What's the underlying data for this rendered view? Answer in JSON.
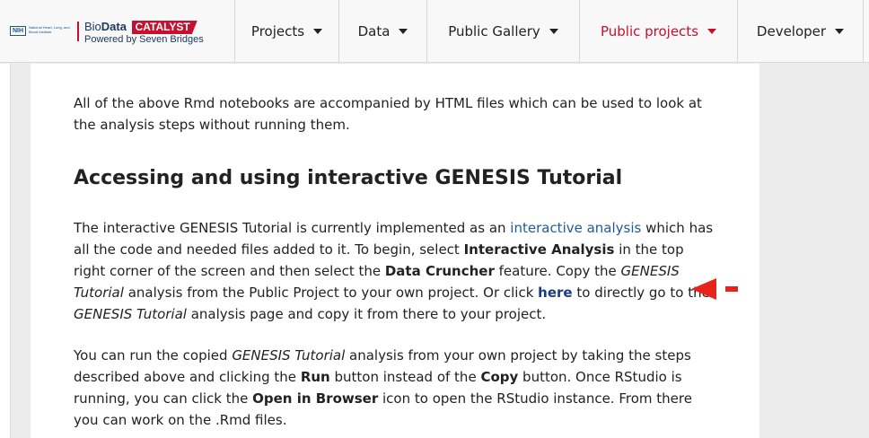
{
  "brand": {
    "nih_badge": "NIH",
    "nih_text": "National Heart, Lung, and Blood Institute",
    "bio": "Bio",
    "data": "Data",
    "catalyst": "CATALYST",
    "powered_by": "Powered by Seven Bridges",
    "accent_color": "#c8102e"
  },
  "nav": {
    "items": [
      {
        "label": "Projects",
        "active": false
      },
      {
        "label": "Data",
        "active": false
      },
      {
        "label": "Public Gallery",
        "active": false
      },
      {
        "label": "Public projects",
        "active": true
      },
      {
        "label": "Developer",
        "active": false
      }
    ]
  },
  "content": {
    "intro": "All of the above Rmd notebooks are accompanied by HTML files which can be used to look at the analysis steps without running them.",
    "heading": "Accessing and using interactive GENESIS Tutorial",
    "p2": {
      "t1": "The interactive GENESIS Tutorial is currently implemented as an ",
      "link1": "interactive analysis",
      "t2": " which has all the code and needed files added to it. To begin, select ",
      "b1": "Interactive Analysis",
      "t3": " in the top right corner of the screen and then select the ",
      "b2": "Data Cruncher",
      "t4": " feature. Copy the ",
      "i1": "GENESIS Tutorial",
      "t5": " analysis from the Public Project to your own project. Or click ",
      "link2": "here",
      "t6": " to directly go to the ",
      "i2": "GENESIS Tutorial",
      "t7": " analysis page and copy it from there to your project."
    },
    "p3": {
      "t1": "You can run the copied ",
      "i1": "GENESIS Tutorial",
      "t2": " analysis from your own project by taking the steps described above and clicking the ",
      "b1": "Run",
      "t3": " button instead of the ",
      "b2": "Copy",
      "t4": " button. Once RStudio is running, you can click the ",
      "b3": "Open in Browser",
      "t5": " icon to open the RStudio instance. From there you can work on the .Rmd files."
    }
  },
  "annotation": {
    "arrow_icon": "red-left-arrow-icon",
    "arrow_color": "#e8241a"
  }
}
